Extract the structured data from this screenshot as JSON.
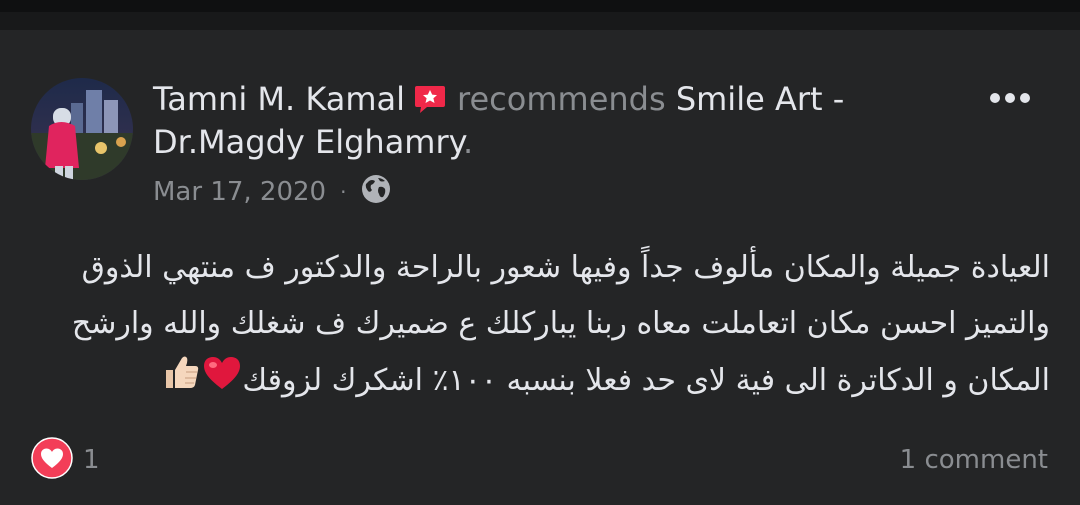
{
  "post": {
    "author_name": "Tamni M. Kamal",
    "recommends_label": "recommends",
    "page_name_line1": "Smile Art -",
    "page_name_line2": "Dr.Magdy Elghamry",
    "trailing_period": ".",
    "date": "Mar 17, 2020",
    "date_separator": "·",
    "privacy_icon": "globe-icon",
    "recommend_badge_icon": "star-badge-icon",
    "more_icon": "more-horizontal-icon",
    "body": "العيادة جميلة والمكان مألوف جداً  وفيها شعور بالراحة والدكتور ف منتهي الذوق والتميز احسن مكان اتعاملت معاه ربنا يباركلك ع ضميرك ف شغلك والله وارشح المكان و الدكاترة الى فية لاى حد فعلا بنسبه ١٠٠٪ اشكرك لزوقك",
    "body_emojis": [
      "red-heart",
      "thumbs-up"
    ]
  },
  "reactions": {
    "icon": "love-reaction-icon",
    "count": "1"
  },
  "comments": {
    "label": "1 comment"
  },
  "colors": {
    "background": "#18191a",
    "card": "#242526",
    "primary_text": "#e4e6eb",
    "secondary_text": "#8a8d91",
    "badge": "#f02849",
    "love": "#f33e58"
  }
}
